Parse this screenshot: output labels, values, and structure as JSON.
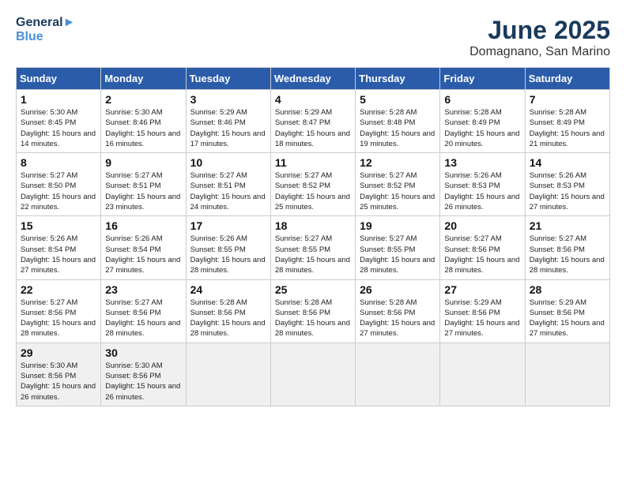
{
  "header": {
    "logo_line1": "General",
    "logo_line2": "Blue",
    "month": "June 2025",
    "location": "Domagnano, San Marino"
  },
  "weekdays": [
    "Sunday",
    "Monday",
    "Tuesday",
    "Wednesday",
    "Thursday",
    "Friday",
    "Saturday"
  ],
  "weeks": [
    [
      {
        "day": "1",
        "sunrise": "5:30 AM",
        "sunset": "8:45 PM",
        "daylight": "15 hours and 14 minutes."
      },
      {
        "day": "2",
        "sunrise": "5:30 AM",
        "sunset": "8:46 PM",
        "daylight": "15 hours and 16 minutes."
      },
      {
        "day": "3",
        "sunrise": "5:29 AM",
        "sunset": "8:46 PM",
        "daylight": "15 hours and 17 minutes."
      },
      {
        "day": "4",
        "sunrise": "5:29 AM",
        "sunset": "8:47 PM",
        "daylight": "15 hours and 18 minutes."
      },
      {
        "day": "5",
        "sunrise": "5:28 AM",
        "sunset": "8:48 PM",
        "daylight": "15 hours and 19 minutes."
      },
      {
        "day": "6",
        "sunrise": "5:28 AM",
        "sunset": "8:49 PM",
        "daylight": "15 hours and 20 minutes."
      },
      {
        "day": "7",
        "sunrise": "5:28 AM",
        "sunset": "8:49 PM",
        "daylight": "15 hours and 21 minutes."
      }
    ],
    [
      {
        "day": "8",
        "sunrise": "5:27 AM",
        "sunset": "8:50 PM",
        "daylight": "15 hours and 22 minutes."
      },
      {
        "day": "9",
        "sunrise": "5:27 AM",
        "sunset": "8:51 PM",
        "daylight": "15 hours and 23 minutes."
      },
      {
        "day": "10",
        "sunrise": "5:27 AM",
        "sunset": "8:51 PM",
        "daylight": "15 hours and 24 minutes."
      },
      {
        "day": "11",
        "sunrise": "5:27 AM",
        "sunset": "8:52 PM",
        "daylight": "15 hours and 25 minutes."
      },
      {
        "day": "12",
        "sunrise": "5:27 AM",
        "sunset": "8:52 PM",
        "daylight": "15 hours and 25 minutes."
      },
      {
        "day": "13",
        "sunrise": "5:26 AM",
        "sunset": "8:53 PM",
        "daylight": "15 hours and 26 minutes."
      },
      {
        "day": "14",
        "sunrise": "5:26 AM",
        "sunset": "8:53 PM",
        "daylight": "15 hours and 27 minutes."
      }
    ],
    [
      {
        "day": "15",
        "sunrise": "5:26 AM",
        "sunset": "8:54 PM",
        "daylight": "15 hours and 27 minutes."
      },
      {
        "day": "16",
        "sunrise": "5:26 AM",
        "sunset": "8:54 PM",
        "daylight": "15 hours and 27 minutes."
      },
      {
        "day": "17",
        "sunrise": "5:26 AM",
        "sunset": "8:55 PM",
        "daylight": "15 hours and 28 minutes."
      },
      {
        "day": "18",
        "sunrise": "5:27 AM",
        "sunset": "8:55 PM",
        "daylight": "15 hours and 28 minutes."
      },
      {
        "day": "19",
        "sunrise": "5:27 AM",
        "sunset": "8:55 PM",
        "daylight": "15 hours and 28 minutes."
      },
      {
        "day": "20",
        "sunrise": "5:27 AM",
        "sunset": "8:56 PM",
        "daylight": "15 hours and 28 minutes."
      },
      {
        "day": "21",
        "sunrise": "5:27 AM",
        "sunset": "8:56 PM",
        "daylight": "15 hours and 28 minutes."
      }
    ],
    [
      {
        "day": "22",
        "sunrise": "5:27 AM",
        "sunset": "8:56 PM",
        "daylight": "15 hours and 28 minutes."
      },
      {
        "day": "23",
        "sunrise": "5:27 AM",
        "sunset": "8:56 PM",
        "daylight": "15 hours and 28 minutes."
      },
      {
        "day": "24",
        "sunrise": "5:28 AM",
        "sunset": "8:56 PM",
        "daylight": "15 hours and 28 minutes."
      },
      {
        "day": "25",
        "sunrise": "5:28 AM",
        "sunset": "8:56 PM",
        "daylight": "15 hours and 28 minutes."
      },
      {
        "day": "26",
        "sunrise": "5:28 AM",
        "sunset": "8:56 PM",
        "daylight": "15 hours and 27 minutes."
      },
      {
        "day": "27",
        "sunrise": "5:29 AM",
        "sunset": "8:56 PM",
        "daylight": "15 hours and 27 minutes."
      },
      {
        "day": "28",
        "sunrise": "5:29 AM",
        "sunset": "8:56 PM",
        "daylight": "15 hours and 27 minutes."
      }
    ],
    [
      {
        "day": "29",
        "sunrise": "5:30 AM",
        "sunset": "8:56 PM",
        "daylight": "15 hours and 26 minutes."
      },
      {
        "day": "30",
        "sunrise": "5:30 AM",
        "sunset": "8:56 PM",
        "daylight": "15 hours and 26 minutes."
      },
      null,
      null,
      null,
      null,
      null
    ]
  ]
}
